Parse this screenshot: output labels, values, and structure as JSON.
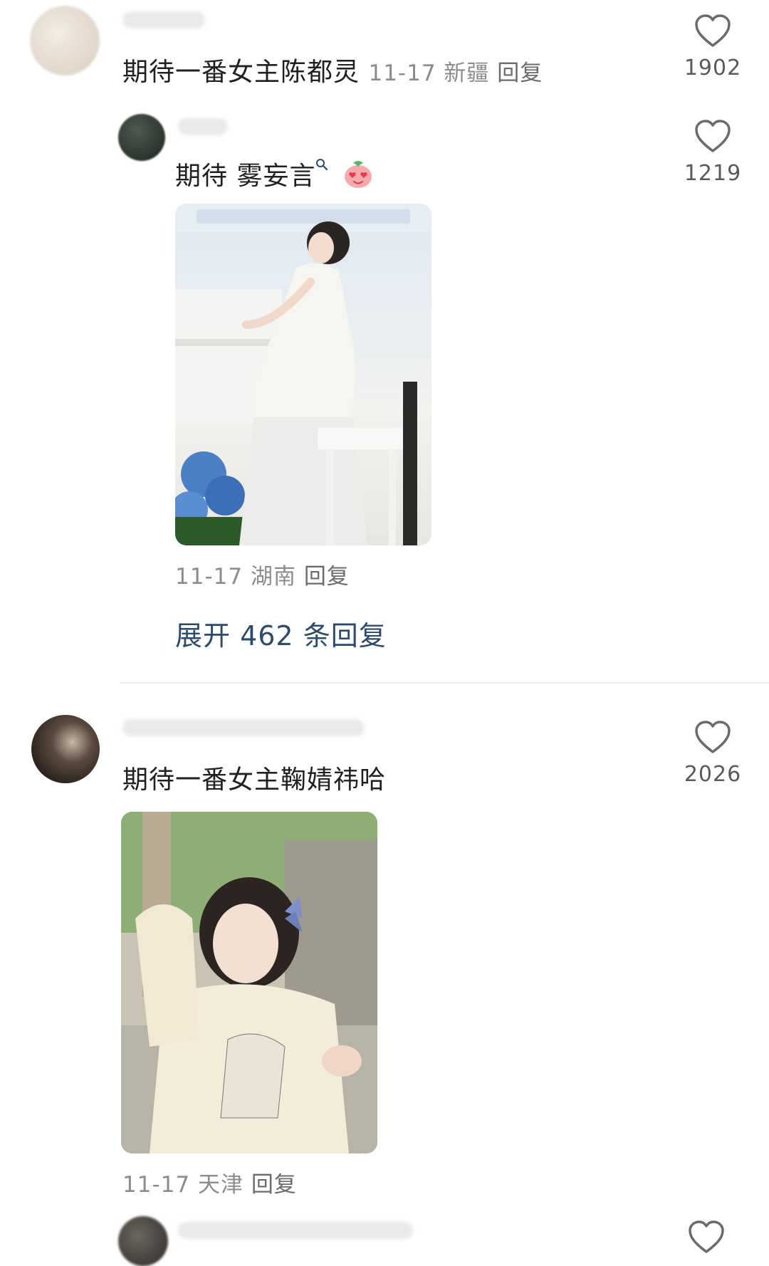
{
  "comments": [
    {
      "text": "期待一番女主陈都灵",
      "date": "11-17",
      "location": "新疆",
      "reply_label": "回复",
      "likes": "1902"
    },
    {
      "text": "期待 雾妄言",
      "search_icon": "search-superscript-icon",
      "emoji": "heart-eyes-peach-emoji",
      "date": "11-17",
      "location": "湖南",
      "reply_label": "回复",
      "likes": "1219",
      "expand_label": "展开 462 条回复"
    },
    {
      "text": "期待一番女主鞠婧祎哈",
      "date": "11-17",
      "location": "天津",
      "reply_label": "回复",
      "likes": "2026"
    }
  ],
  "colors": {
    "text": "#202020",
    "meta": "#8c8c8c",
    "link": "#2e4a6a",
    "icon": "#6b6b6b"
  }
}
